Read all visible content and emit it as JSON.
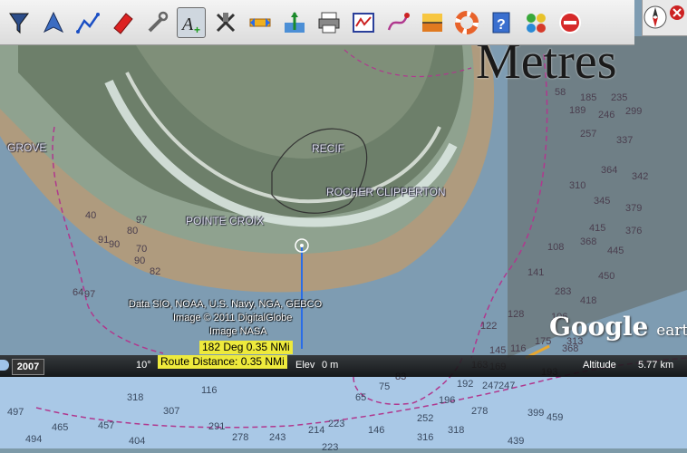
{
  "toolbar": {
    "tools": [
      {
        "icon": "funnel-icon",
        "name": "tool-filter"
      },
      {
        "icon": "boat-position-icon",
        "name": "tool-boat"
      },
      {
        "icon": "route-line-icon",
        "name": "tool-route"
      },
      {
        "icon": "eraser-icon",
        "name": "tool-erase"
      },
      {
        "icon": "wrench-icon",
        "name": "tool-settings"
      },
      {
        "icon": "add-text-icon",
        "name": "tool-add-text",
        "active": true
      },
      {
        "icon": "delete-tool-icon",
        "name": "tool-delete"
      },
      {
        "icon": "measure-distance-icon",
        "name": "tool-measure"
      },
      {
        "icon": "tide-level-icon",
        "name": "tool-tide"
      },
      {
        "icon": "print-icon",
        "name": "tool-print"
      },
      {
        "icon": "chart-window-icon",
        "name": "tool-chart-window"
      },
      {
        "icon": "track-icon",
        "name": "tool-track"
      },
      {
        "icon": "sunset-icon",
        "name": "tool-sunset"
      },
      {
        "icon": "lifebuoy-icon",
        "name": "tool-mob"
      },
      {
        "icon": "help-icon",
        "name": "tool-help"
      },
      {
        "icon": "layers-icon",
        "name": "tool-layers"
      },
      {
        "icon": "stop-sign-icon",
        "name": "tool-stop"
      }
    ]
  },
  "map": {
    "scale_overlay_text": "Metres",
    "place_labels": {
      "grove": "GROVE",
      "recif": "RECIF",
      "rocher": "ROCHER CLIPPERTON",
      "pointe": "POINTE CROIX"
    },
    "credits": [
      "Data SIO, NOAA, U.S. Navy, NGA, GEBCO",
      "Image © 2011 DigitalGlobe",
      "Image NASA"
    ],
    "route_info": {
      "bearing_line": "182 Deg  0.35 NMi",
      "route_distance": "Route Distance:  0.35 NMi"
    },
    "google_earth_logo": "Google",
    "google_earth_suffix": "earth",
    "depth_soundings": {
      "d01": "58",
      "d02": "185",
      "d03": "235",
      "d04": "189",
      "d05": "246",
      "d06": "299",
      "d07": "257",
      "d08": "337",
      "d09": "364",
      "d10": "342",
      "d11": "310",
      "d12": "345",
      "d13": "379",
      "d14": "415",
      "d15": "108",
      "d16": "368",
      "d17": "445",
      "d18": "376",
      "d19": "450",
      "d20": "141",
      "d21": "283",
      "d22": "418",
      "d23": "128",
      "d24": "106",
      "d25": "313",
      "d26": "175",
      "d27": "122",
      "d28": "368",
      "d29": "145",
      "d30": "116",
      "d31": "163",
      "d32": "169",
      "d33": "247",
      "d34": "193",
      "d35": "318",
      "d36": "307",
      "d37": "116",
      "d38": "65",
      "d39": "75",
      "d40": "83",
      "d41": "192",
      "d42": "247",
      "d43": "196",
      "d44": "278",
      "d45": "399",
      "d46": "459",
      "d47": "497",
      "d48": "465",
      "d49": "457",
      "d50": "291",
      "d51": "278",
      "d52": "243",
      "d53": "214",
      "d54": "223",
      "d55": "146",
      "d56": "252",
      "d57": "316",
      "d58": "318",
      "d59": "494",
      "d60": "404",
      "d61": "439",
      "d62": "223",
      "d63": "97",
      "d64": "40",
      "d65": "91",
      "d66": "90",
      "d67": "80",
      "d68": "70",
      "d69": "82",
      "d70": "64",
      "d71": "97",
      "d72": "90"
    }
  },
  "statusbar": {
    "year": "2007",
    "heading_label": "10°",
    "elev_label": "Elev",
    "elev_value": "0 m",
    "altitude_label": "Altitude",
    "altitude_value": "5.77 km"
  },
  "colors": {
    "deep_water": "#7e9cb2",
    "shallow_water": "#a9c8e6",
    "land": "#6d7f6a",
    "sand": "#b79b74",
    "reef_foam": "#d9e6e0",
    "depth_contour": "#b0388e",
    "depth_text": "#2d3748",
    "route_line": "#2a6de8",
    "route_box": "#eeea3c"
  }
}
